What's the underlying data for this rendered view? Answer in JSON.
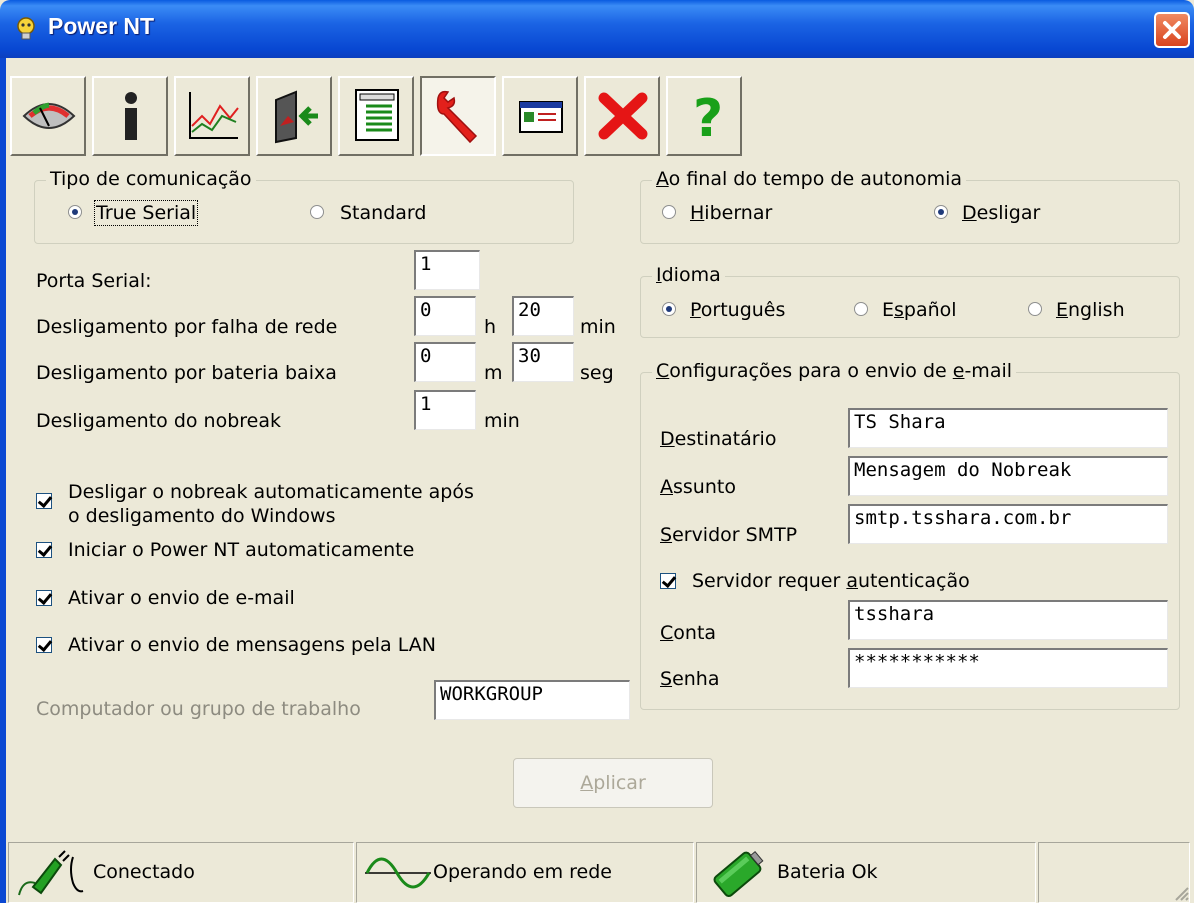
{
  "window": {
    "title": "Power NT"
  },
  "toolbar": {
    "buttons": [
      {
        "icon": "gauge-icon",
        "label": "Monitor"
      },
      {
        "icon": "info-icon",
        "label": "Informações"
      },
      {
        "icon": "chart-icon",
        "label": "Gráfico"
      },
      {
        "icon": "exit-door-icon",
        "label": "Sair"
      },
      {
        "icon": "document-icon",
        "label": "Log"
      },
      {
        "icon": "wrench-icon",
        "label": "Configurações",
        "active": true
      },
      {
        "icon": "window-form-icon",
        "label": "Janela"
      },
      {
        "icon": "close-red-icon",
        "label": "Fechar"
      },
      {
        "icon": "help-icon",
        "label": "Ajuda"
      }
    ]
  },
  "comm": {
    "legend": "Tipo de comunicação",
    "option1": "True Serial",
    "option2": "Standard",
    "selected": "True Serial"
  },
  "autonomy": {
    "legend_prefix": "A",
    "legend_rest": "o final do tempo de autonomia",
    "opt1_prefix": "H",
    "opt1_rest": "ibernar",
    "opt2_prefix": "D",
    "opt2_rest": "esligar",
    "selected": "Desligar"
  },
  "language": {
    "legend_prefix": "I",
    "legend_rest": "dioma",
    "opt1_prefix": "P",
    "opt1_rest": "ortuguês",
    "opt2_a": "E",
    "opt2_u": "s",
    "opt2_rest": "pañol",
    "opt3_prefix": "E",
    "opt3_rest": "nglish",
    "selected": "Português"
  },
  "settings": {
    "serial_port_label": "Porta Serial:",
    "serial_port_value": "1",
    "power_fail_label": "Desligamento por falha de rede",
    "power_fail_h": "0",
    "power_fail_h_unit": "h",
    "power_fail_min": "20",
    "power_fail_min_unit": "min",
    "low_batt_label": "Desligamento por bateria baixa",
    "low_batt_m": "0",
    "low_batt_m_unit": "m",
    "low_batt_seg": "30",
    "low_batt_seg_unit": "seg",
    "ups_off_label": "Desligamento do nobreak",
    "ups_off_value": "1",
    "ups_off_unit": "min"
  },
  "checks": {
    "auto_off_line1": "Desligar o nobreak automaticamente após",
    "auto_off_line2": "o desligamento do Windows",
    "start_auto": "Iniciar o Power NT automaticamente",
    "email_enable": "Ativar o envio de e-mail",
    "lan_enable": "Ativar o envio de mensagens pela LAN"
  },
  "workgroup": {
    "label": "Computador ou grupo de trabalho",
    "value": "WORKGROUP"
  },
  "email": {
    "legend_c": "C",
    "legend_mid": "onfigurações para o envio de ",
    "legend_e": "e",
    "legend_rest": "-mail",
    "to_prefix": "D",
    "to_rest": "estinatário",
    "to_value": "TS Shara",
    "subject_prefix": "A",
    "subject_rest": "ssunto",
    "subject_value": "Mensagem do Nobreak",
    "smtp_prefix": "S",
    "smtp_rest": "ervidor SMTP",
    "smtp_value": "smtp.tsshara.com.br",
    "auth_pre": "Servidor requer ",
    "auth_u": "a",
    "auth_rest": "utenticação",
    "account_prefix": "C",
    "account_rest": "onta",
    "account_value": "tsshara",
    "password_prefix": "S",
    "password_rest": "enha",
    "password_value": "***********"
  },
  "apply": {
    "prefix": "A",
    "rest": "plicar"
  },
  "status": {
    "connection": "Conectado",
    "power": "Operando em rede",
    "battery": "Bateria Ok"
  }
}
